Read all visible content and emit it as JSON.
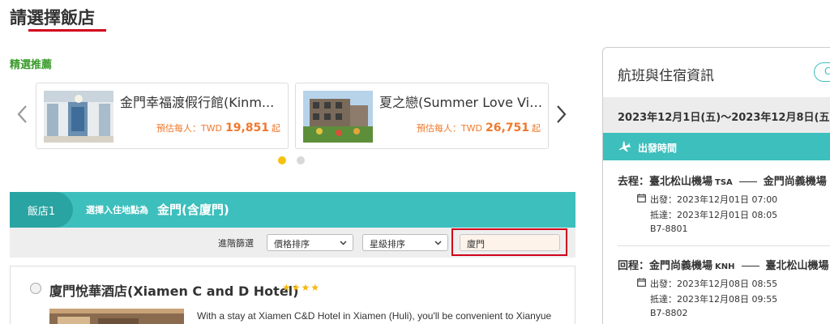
{
  "page": {
    "title": "請選擇飯店"
  },
  "featured": {
    "label": "精選推薦",
    "cards": [
      {
        "name": "金門幸福渡假行館(Kinm...",
        "price_prefix": "預估每人：TWD",
        "price": "19,851",
        "price_suffix": "起"
      },
      {
        "name": "夏之戀(Summer Love Villa)",
        "price_prefix": "預估每人：TWD",
        "price": "26,751",
        "price_suffix": "起"
      }
    ]
  },
  "hotel_bar": {
    "tab_label": "飯店1",
    "choose_label": "選擇入住地點為",
    "destination": "金門(含廈門)"
  },
  "filters": {
    "label": "進階篩選",
    "price_sort": "價格排序",
    "star_sort": "星級排序",
    "search_value": "廈門"
  },
  "result": {
    "name": "廈門悅華酒店(Xiamen C and D Hotel)",
    "stars": "★★★★",
    "description": "With a stay at Xiamen C&D Hotel in Xiamen (Huli), you'll be convenient to Xianyue"
  },
  "panel": {
    "title": "航班與住宿資訊",
    "pill_text": "C",
    "date_range": "2023年12月1日(五)～2023年12月8日(五)",
    "depart_label": "出發時間",
    "outbound": {
      "route_prefix": "去程：",
      "from": "臺北松山機場",
      "from_code": "TSA",
      "to": "金門尚義機場",
      "depart": "出發：2023年12月01日 07:00",
      "arrive": "抵達：2023年12月01日 08:05",
      "flight_no": "B7-8801"
    },
    "return": {
      "route_prefix": "回程：",
      "from": "金門尚義機場",
      "from_code": "KNH",
      "to": "臺北松山機場",
      "depart": "出發：2023年12月08日 08:55",
      "arrive": "抵達：2023年12月08日 09:55",
      "flight_no": "B7-8802"
    }
  },
  "colors": {
    "accent": "#3dbfbd",
    "accent_dark": "#2aa4a3",
    "price": "#f0782c",
    "title_underline": "#d0021b",
    "featured": "#3a9b2a",
    "star": "#f5b70e"
  },
  "icons": [
    "chevron-left-icon",
    "chevron-right-icon",
    "chevron-down-icon",
    "plane-icon",
    "calendar-icon"
  ],
  "carousel": {
    "active_index": 0,
    "total": 2
  }
}
